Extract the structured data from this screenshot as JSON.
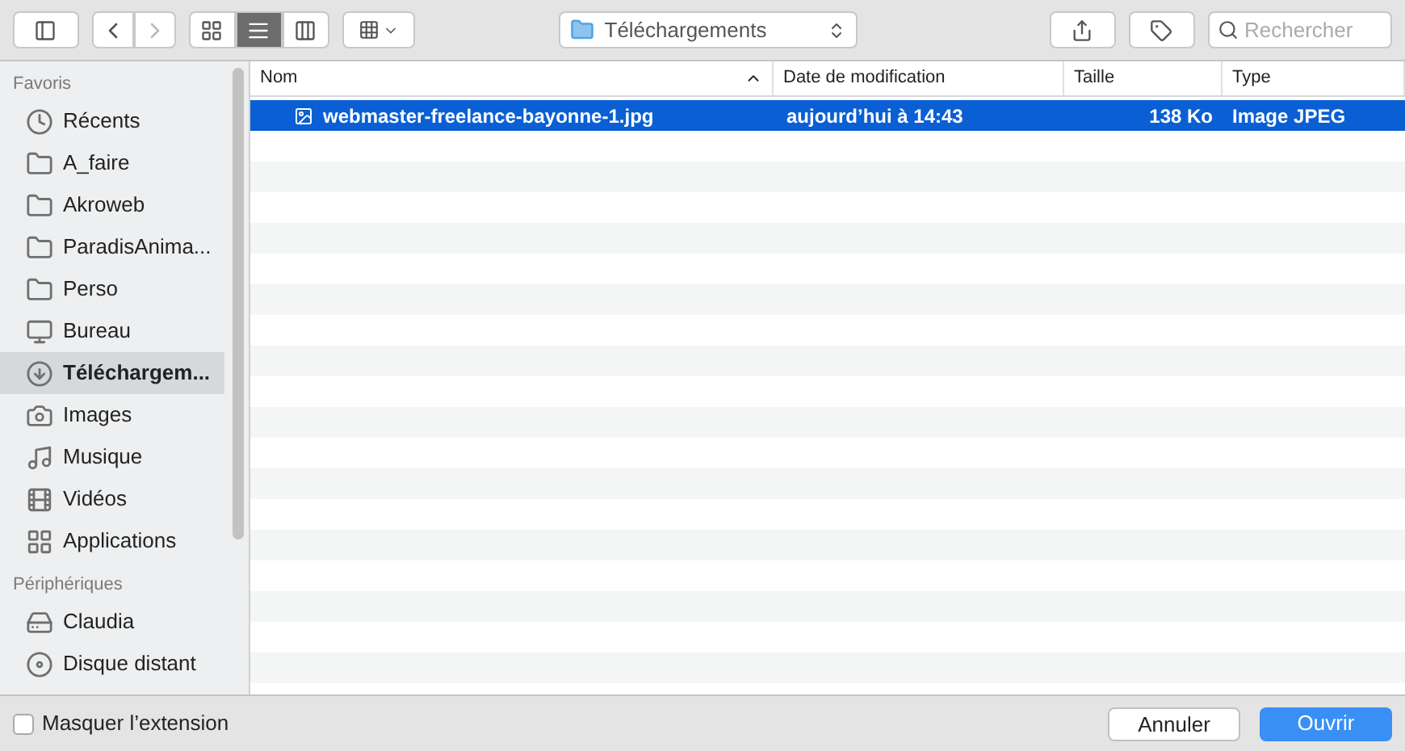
{
  "toolbar": {
    "views": [
      {
        "kind": "icons",
        "selected": false
      },
      {
        "kind": "list",
        "selected": true
      },
      {
        "kind": "columns",
        "selected": false
      }
    ],
    "location": "Téléchargements",
    "search": {
      "placeholder": "Rechercher"
    }
  },
  "sidebar": {
    "sections": [
      {
        "title": "Favoris",
        "items": [
          {
            "label": "Récents",
            "kind": "recents",
            "selected": false
          },
          {
            "label": "A_faire",
            "kind": "folder",
            "selected": false
          },
          {
            "label": "Akroweb",
            "kind": "folder",
            "selected": false
          },
          {
            "label": "ParadisAnima...",
            "kind": "folder",
            "selected": false
          },
          {
            "label": "Perso",
            "kind": "folder",
            "selected": false
          },
          {
            "label": "Bureau",
            "kind": "desktop",
            "selected": false
          },
          {
            "label": "Téléchargem...",
            "kind": "downloads",
            "selected": true
          },
          {
            "label": "Images",
            "kind": "camera",
            "selected": false
          },
          {
            "label": "Musique",
            "kind": "music",
            "selected": false
          },
          {
            "label": "Vidéos",
            "kind": "film",
            "selected": false
          },
          {
            "label": "Applications",
            "kind": "apps",
            "selected": false
          }
        ]
      },
      {
        "title": "Périphériques",
        "items": [
          {
            "label": "Claudia",
            "kind": "disk",
            "selected": false
          },
          {
            "label": "Disque distant",
            "kind": "disc",
            "selected": false
          }
        ]
      }
    ]
  },
  "table": {
    "columns": [
      {
        "label": "Nom",
        "sorted": true
      },
      {
        "label": "Date de modification",
        "sorted": false
      },
      {
        "label": "Taille",
        "sorted": false
      },
      {
        "label": "Type",
        "sorted": false
      }
    ],
    "rows": [
      {
        "name": "webmaster-freelance-bayonne-1.jpg",
        "date": "aujourd’hui à 14:43",
        "size": "138 Ko",
        "type": "Image JPEG",
        "selected": true
      }
    ]
  },
  "footer": {
    "hide_extension": {
      "label": "Masquer l’extension",
      "checked": false
    },
    "buttons": [
      {
        "label": "Annuler",
        "kind": "secondary"
      },
      {
        "label": "Ouvrir",
        "kind": "primary"
      }
    ]
  }
}
